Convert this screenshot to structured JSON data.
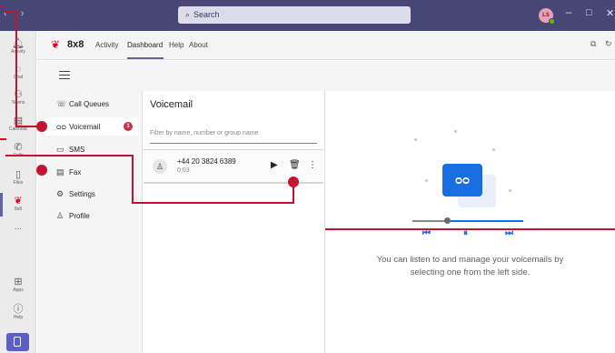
{
  "window": {
    "nav_arrows": "‹ ›",
    "search_placeholder": "Search",
    "avatar_initials": "LS",
    "controls": [
      "–",
      "□",
      "✕"
    ]
  },
  "rail": {
    "items": [
      {
        "label": "Activity",
        "icon": "bell-icon"
      },
      {
        "label": "Chat",
        "icon": "chat-icon"
      },
      {
        "label": "Teams",
        "icon": "teams-icon"
      },
      {
        "label": "Calendar",
        "icon": "calendar-icon"
      },
      {
        "label": "Calls",
        "icon": "phone-icon"
      },
      {
        "label": "Files",
        "icon": "file-icon"
      },
      {
        "label": "8x8",
        "icon": "8x8-logo-icon"
      }
    ],
    "more": "...",
    "apps_label": "Apps",
    "help_label": "Help"
  },
  "header": {
    "brand": "8x8",
    "tabs": [
      "Activity",
      "Dashboard",
      "Help",
      "About"
    ],
    "active_tab": "Dashboard"
  },
  "menu": {
    "items": [
      {
        "label": "Call Queues",
        "icon": "call-queues-icon"
      },
      {
        "label": "Voicemail",
        "icon": "voicemail-icon",
        "badge": "1",
        "selected": true
      },
      {
        "label": "SMS",
        "icon": "sms-icon"
      },
      {
        "label": "Fax",
        "icon": "fax-icon"
      },
      {
        "label": "Settings",
        "icon": "gear-icon"
      },
      {
        "label": "Profile",
        "icon": "person-icon"
      }
    ]
  },
  "voicemail": {
    "title": "Voicemail",
    "filter_placeholder": "Filter by name, number or group name",
    "items": [
      {
        "number": "+44 20 3824 6389",
        "duration": "0:03"
      }
    ]
  },
  "detail": {
    "empty_message": "You can listen to and manage your voicemails by selecting one from the left side."
  },
  "colors": {
    "titlebar": "#464775",
    "accent": "#6264a7",
    "brand_red": "#d4002b",
    "annotation": "#c4122f",
    "player_blue": "#1a6fe0"
  }
}
